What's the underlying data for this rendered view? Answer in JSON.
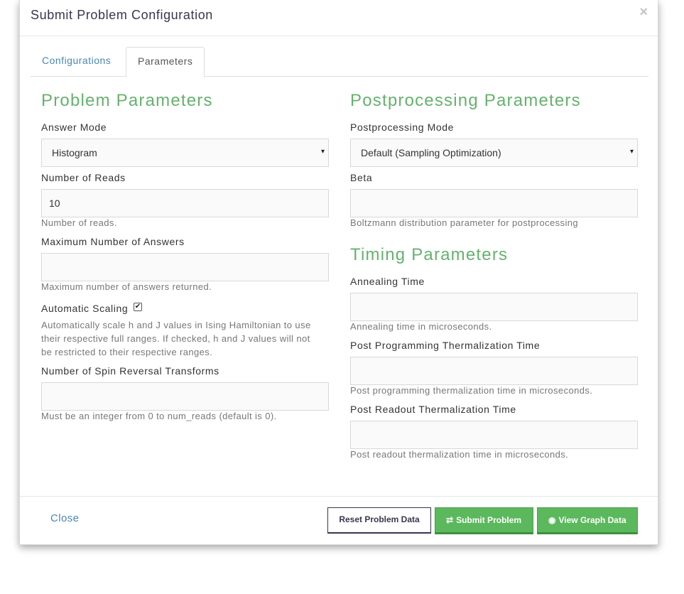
{
  "modal": {
    "title": "Submit Problem Configuration",
    "close_symbol": "×"
  },
  "tabs": [
    {
      "label": "Configurations",
      "active": false
    },
    {
      "label": "Parameters",
      "active": true
    }
  ],
  "problem_parameters": {
    "title": "Problem Parameters",
    "answer_mode": {
      "label": "Answer Mode",
      "value": "Histogram"
    },
    "num_reads": {
      "label": "Number of Reads",
      "value": "10",
      "help": "Number of reads."
    },
    "max_answers": {
      "label": "Maximum Number of Answers",
      "value": "",
      "help": "Maximum number of answers returned."
    },
    "auto_scale": {
      "label": "Automatic Scaling",
      "checked": true,
      "help_lines": [
        "Automatically scale h and J values in Ising Hamiltonian to use",
        "their respective full ranges. If checked, h and J values will not",
        "be restricted to their respective ranges."
      ]
    },
    "spin_reversal": {
      "label": "Number of Spin Reversal Transforms",
      "value": "",
      "help": "Must be an integer from 0 to num_reads (default is 0)."
    }
  },
  "postprocessing_parameters": {
    "title": "Postprocessing Parameters",
    "mode": {
      "label": "Postprocessing Mode",
      "value": "Default (Sampling Optimization)"
    },
    "beta": {
      "label": "Beta",
      "value": "",
      "help": "Boltzmann distribution parameter for postprocessing"
    }
  },
  "timing_parameters": {
    "title": "Timing Parameters",
    "annealing_time": {
      "label": "Annealing Time",
      "value": "",
      "help": "Annealing time in microseconds."
    },
    "post_programming": {
      "label": "Post Programming Thermalization Time",
      "value": "",
      "help": "Post programming thermalization time in microseconds."
    },
    "post_readout": {
      "label": "Post Readout Thermalization Time",
      "value": "",
      "help": "Post readout thermalization time in microseconds."
    }
  },
  "footer": {
    "close_label": "Close",
    "reset_label": "Reset Problem Data",
    "submit_label": "Submit Problem",
    "submit_icon": "⇄",
    "graph_label": "View Graph Data",
    "graph_icon": "👁"
  },
  "colors": {
    "accent_green": "#65b26d",
    "button_green": "#5cb85c",
    "link_blue": "#4a87b5",
    "title_navy": "#3a3550"
  }
}
